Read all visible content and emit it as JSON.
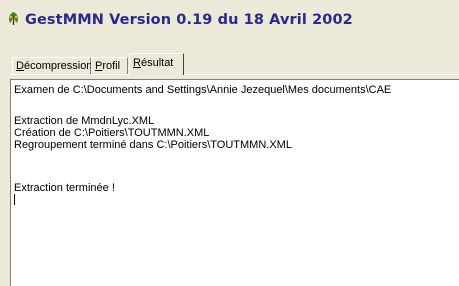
{
  "window": {
    "title": "GestMMN  Version 0.19 du 18 Avril 2002",
    "icon": "leaf-app-icon"
  },
  "tabs": [
    {
      "label": "Décompression",
      "mnemonic": "D",
      "active": false
    },
    {
      "label": "Profil",
      "mnemonic": "P",
      "active": false
    },
    {
      "label": "Résultat",
      "mnemonic": "R",
      "active": true
    }
  ],
  "log": {
    "lines": [
      "Examen de C:\\Documents and Settings\\Annie Jezequel\\Mes documents\\CAE",
      "",
      "Extraction de MmdnLyc.XML",
      "Création de C:\\Poitiers\\TOUTMMN.XML",
      "Regroupement terminé dans C:\\Poitiers\\TOUTMMN.XML",
      "",
      "Extraction terminée !"
    ]
  },
  "colors": {
    "title_text": "#2a2a8c",
    "background": "#ece9d8",
    "textarea_bg": "#ffffff"
  }
}
